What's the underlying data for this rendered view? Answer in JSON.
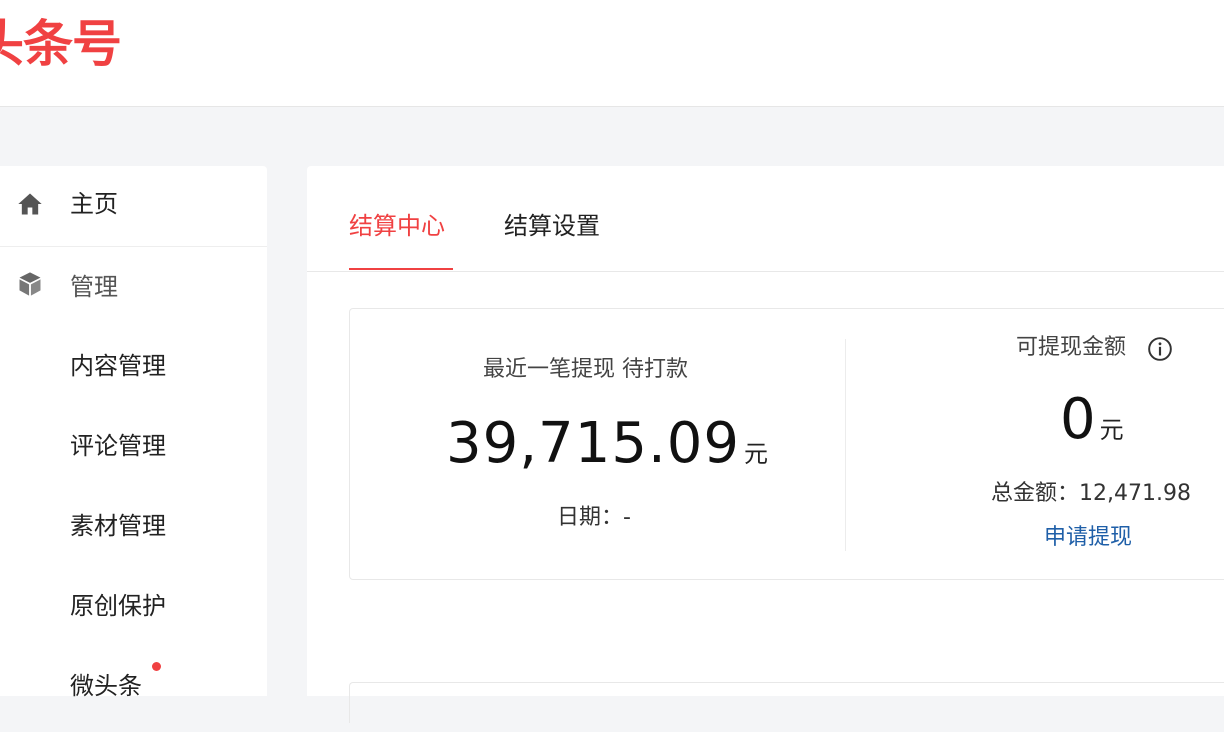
{
  "header": {
    "logo_text": "头条号"
  },
  "sidebar": {
    "items": [
      {
        "label": "主页",
        "icon": "home-icon"
      },
      {
        "label": "管理",
        "icon": "cube-icon"
      },
      {
        "label": "内容管理"
      },
      {
        "label": "评论管理"
      },
      {
        "label": "素材管理"
      },
      {
        "label": "原创保护"
      },
      {
        "label": "微头条",
        "badge": "red-dot"
      }
    ]
  },
  "tabs": [
    {
      "label": "结算中心",
      "active": true
    },
    {
      "label": "结算设置",
      "active": false
    }
  ],
  "withdraw": {
    "recent_label": "最近一笔提现 待打款",
    "recent_amount": "39,715.09",
    "recent_unit": "元",
    "date_text": "日期：-",
    "available_label": "可提现金额",
    "available_amount": "0",
    "available_unit": "元",
    "total_text": "总金额：12,471.98",
    "apply_link": "申请提现"
  },
  "colors": {
    "brand": "#f04142",
    "link": "#1f5fa8",
    "background": "#f4f5f7"
  }
}
